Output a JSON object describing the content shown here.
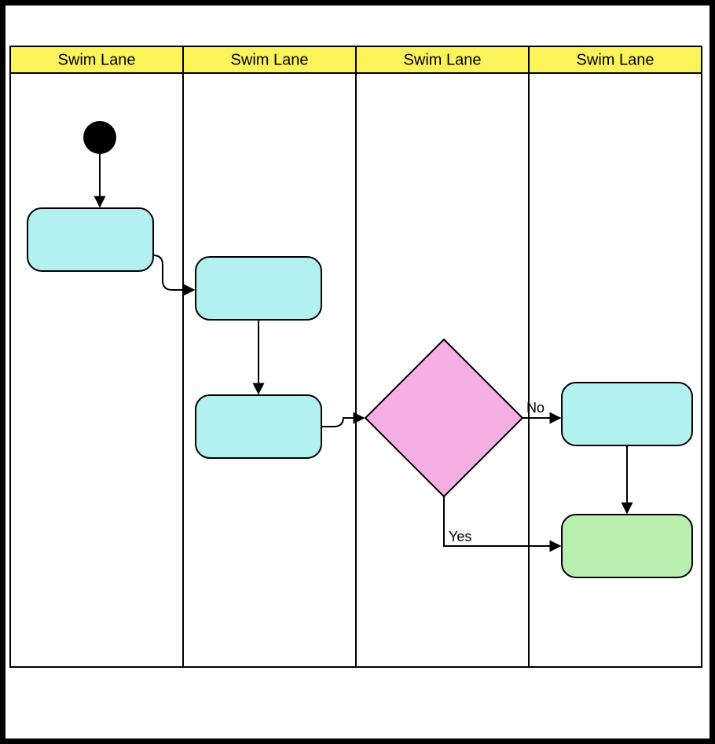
{
  "diagram": {
    "type": "swimlane-flowchart",
    "lanes": [
      {
        "label": "Swim Lane"
      },
      {
        "label": "Swim Lane"
      },
      {
        "label": "Swim Lane"
      },
      {
        "label": "Swim Lane"
      }
    ],
    "nodes": {
      "start": {
        "kind": "start",
        "lane": 0
      },
      "act1": {
        "kind": "activity",
        "lane": 0,
        "label": ""
      },
      "act2": {
        "kind": "activity",
        "lane": 1,
        "label": ""
      },
      "act3": {
        "kind": "activity",
        "lane": 1,
        "label": ""
      },
      "decision": {
        "kind": "decision",
        "lane": 2,
        "label": ""
      },
      "act4": {
        "kind": "activity",
        "lane": 3,
        "label": ""
      },
      "act5": {
        "kind": "activity",
        "lane": 3,
        "label": "",
        "color": "green"
      }
    },
    "edges": [
      {
        "from": "start",
        "to": "act1",
        "label": ""
      },
      {
        "from": "act1",
        "to": "act2",
        "label": ""
      },
      {
        "from": "act2",
        "to": "act3",
        "label": ""
      },
      {
        "from": "act3",
        "to": "decision",
        "label": ""
      },
      {
        "from": "decision",
        "to": "act4",
        "label": "No"
      },
      {
        "from": "decision",
        "to": "act5",
        "label": "Yes"
      },
      {
        "from": "act4",
        "to": "act5",
        "label": ""
      }
    ],
    "colors": {
      "laneHeader": "#faf35a",
      "activity": "#b3f0f0",
      "activityAlt": "#baeeb0",
      "decision": "#f5aee1",
      "start": "#000000"
    }
  }
}
